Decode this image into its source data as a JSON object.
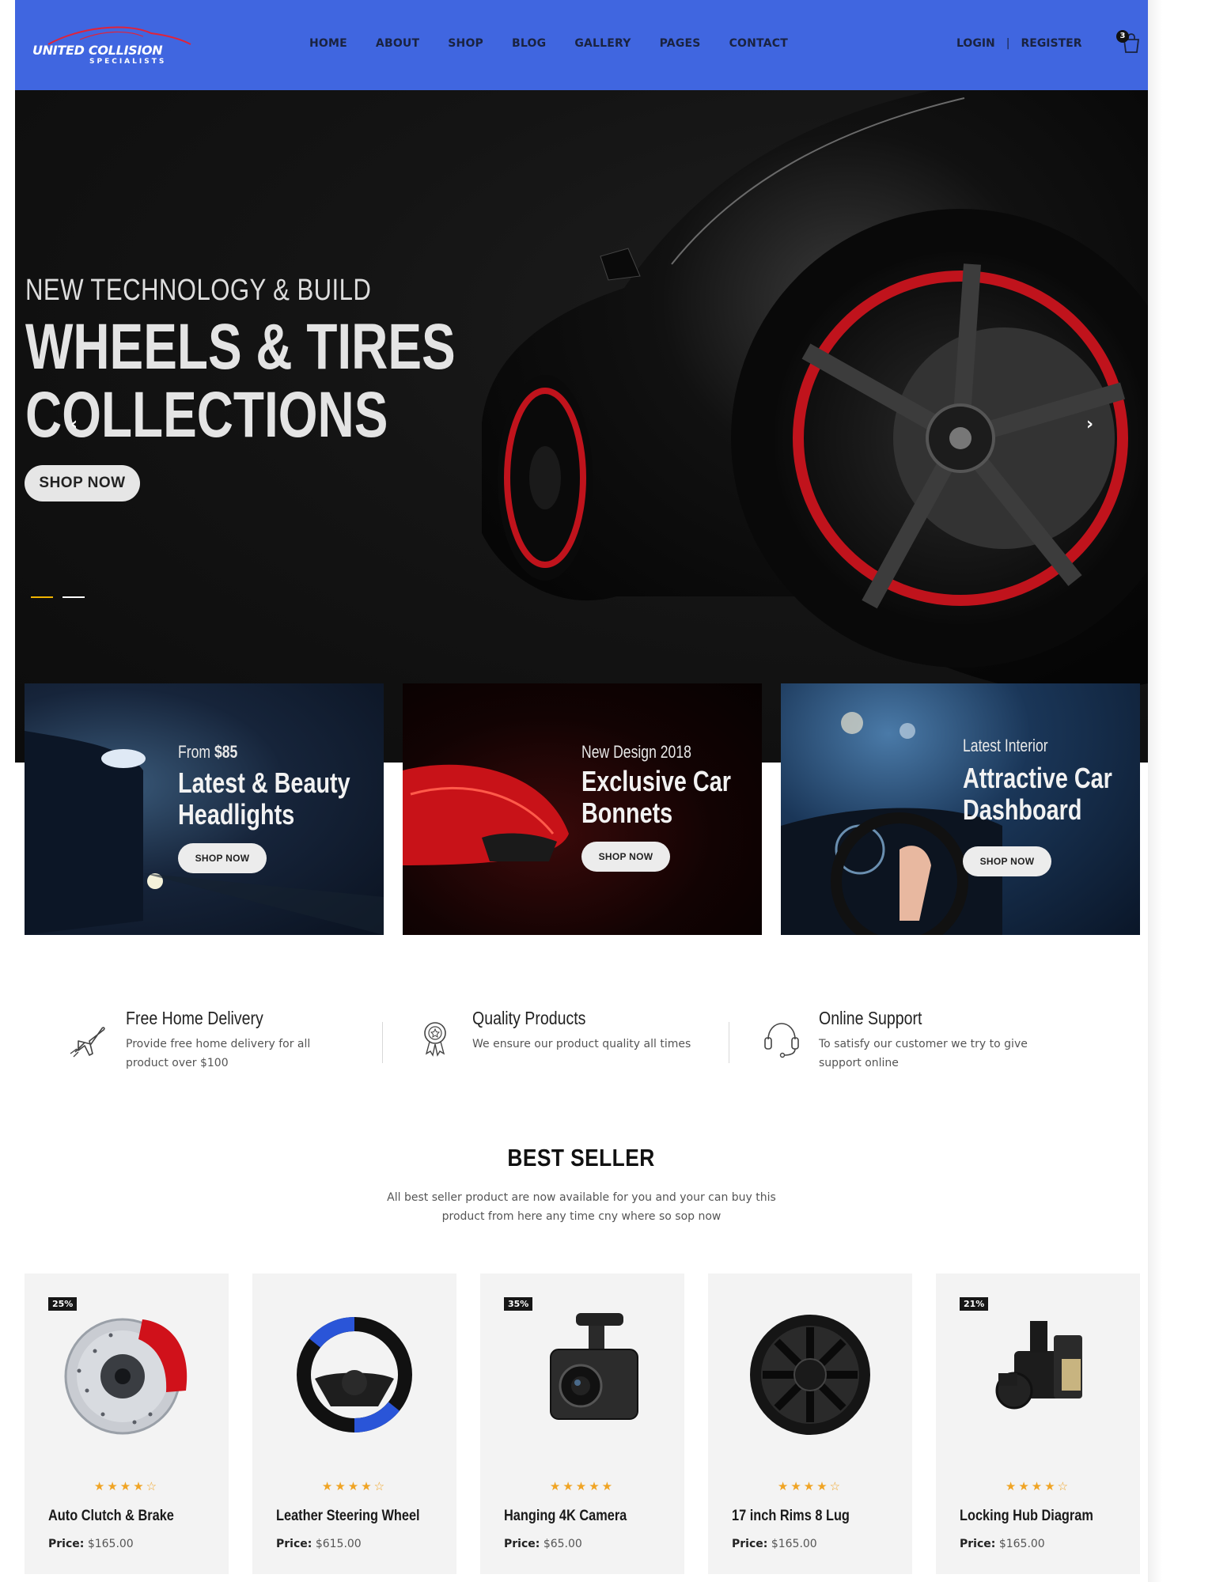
{
  "brand": {
    "line1": "UNITED COLLISION",
    "line2": "SPECIALISTS"
  },
  "nav": {
    "items": [
      "HOME",
      "ABOUT",
      "SHOP",
      "BLOG",
      "GALLERY",
      "PAGES",
      "CONTACT"
    ]
  },
  "auth": {
    "login": "LOGIN",
    "separator": "|",
    "register": "REGISTER"
  },
  "cart": {
    "count": "3",
    "icon": "shopping-bag-icon"
  },
  "hero": {
    "subtitle": "NEW TECHNOLOGY & BUILD",
    "title_line1": "WHEELS & TIRES",
    "title_line2": "COLLECTIONS",
    "button": "SHOP NOW",
    "prev_arrow": "‹",
    "next_arrow": "›",
    "active_slide": 1,
    "slide_count": 2,
    "accent": "#f0b400"
  },
  "promos": [
    {
      "small_prefix": "From ",
      "small_value": "$85",
      "line1": "Latest & Beauty",
      "line2": "Headlights",
      "button": "SHOP NOW"
    },
    {
      "small_prefix": "New Design 2018",
      "small_value": "",
      "line1": "Exclusive Car",
      "line2": "Bonnets",
      "button": "SHOP NOW"
    },
    {
      "small_prefix": "Latest Interior",
      "small_value": "",
      "line1": "Attractive Car",
      "line2": "Dashboard",
      "button": "SHOP NOW"
    }
  ],
  "features": [
    {
      "icon": "airplane-delivery-icon",
      "title": "Free Home Delivery",
      "desc": "Provide free home delivery for all product over $100"
    },
    {
      "icon": "award-badge-icon",
      "title": "Quality Products",
      "desc": "We ensure our product quality all times"
    },
    {
      "icon": "headset-support-icon",
      "title": "Online Support",
      "desc": "To satisfy our customer we try to give support online"
    }
  ],
  "best_seller": {
    "title": "BEST SELLER",
    "desc": "All best seller product are now available for you and your can buy this product from here any time cny where so sop now"
  },
  "products": [
    {
      "name": "Auto Clutch & Brake",
      "price_label": "Price:",
      "price": "$165.00",
      "discount": "25%",
      "rating": 4.5,
      "stars": "★★★★☆"
    },
    {
      "name": "Leather Steering Wheel",
      "price_label": "Price:",
      "price": "$615.00",
      "discount": "",
      "rating": 3.5,
      "stars": "★★★★☆"
    },
    {
      "name": "Hanging 4K Camera",
      "price_label": "Price:",
      "price": "$65.00",
      "discount": "35%",
      "rating": 5,
      "stars": "★★★★★"
    },
    {
      "name": "17 inch Rims 8 Lug",
      "price_label": "Price:",
      "price": "$165.00",
      "discount": "",
      "rating": 4.5,
      "stars": "★★★★☆"
    },
    {
      "name": "Locking Hub Diagram",
      "price_label": "Price:",
      "price": "$165.00",
      "discount": "21%",
      "rating": 4.5,
      "stars": "★★★★☆"
    }
  ],
  "colors": {
    "header": "#4066e0",
    "star": "#f0a424",
    "nav_text": "#1a2340"
  }
}
